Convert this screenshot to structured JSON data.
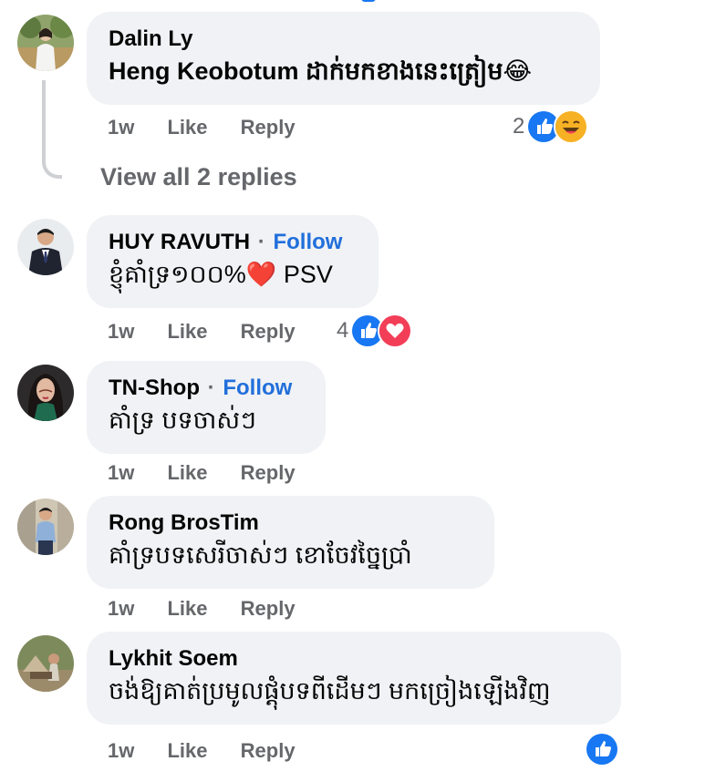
{
  "comments": [
    {
      "author": "Dalin Ly",
      "show_follow": false,
      "text": "Heng Keobotum ដាក់មកខាងនេះត្រៀម😂",
      "time": "1w",
      "like": "Like",
      "reply": "Reply",
      "reaction_count": "2",
      "reactions": [
        "like-icon",
        "laughing-emoji-icon"
      ],
      "view_replies": "View all 2 replies"
    },
    {
      "author": "HUY RAVUTH",
      "show_follow": true,
      "follow": "Follow",
      "separator": "·",
      "text": "ខ្ញុំគាំទ្រ១០០%❤️ PSV",
      "time": "1w",
      "like": "Like",
      "reply": "Reply",
      "reaction_count": "4",
      "reactions": [
        "like-icon",
        "love-icon"
      ]
    },
    {
      "author": "TN-Shop",
      "show_follow": true,
      "follow": "Follow",
      "separator": "·",
      "text": "គាំទ្រ បទចាស់ៗ",
      "time": "1w",
      "like": "Like",
      "reply": "Reply"
    },
    {
      "author": "Rong BrosTim",
      "show_follow": false,
      "text": "គាំទ្របទសេរីចាស់ៗ ខោចែវច្នៃប្រាំ",
      "time": "1w",
      "like": "Like",
      "reply": "Reply"
    },
    {
      "author": "Lykhit Soem",
      "show_follow": false,
      "text": "ចង់ឱ្យគាត់ប្រមូលផ្តុំបទពីដើមៗ មកច្រៀងឡើងវិញ",
      "time": "1w",
      "like": "Like",
      "reply": "Reply",
      "reactions": [
        "like-icon"
      ]
    }
  ],
  "colors": {
    "bubble": "#f0f2f5",
    "link_blue": "#216fdb",
    "meta_gray": "#65676b",
    "like_blue": "#1877f2",
    "love_red": "#f33e58"
  }
}
